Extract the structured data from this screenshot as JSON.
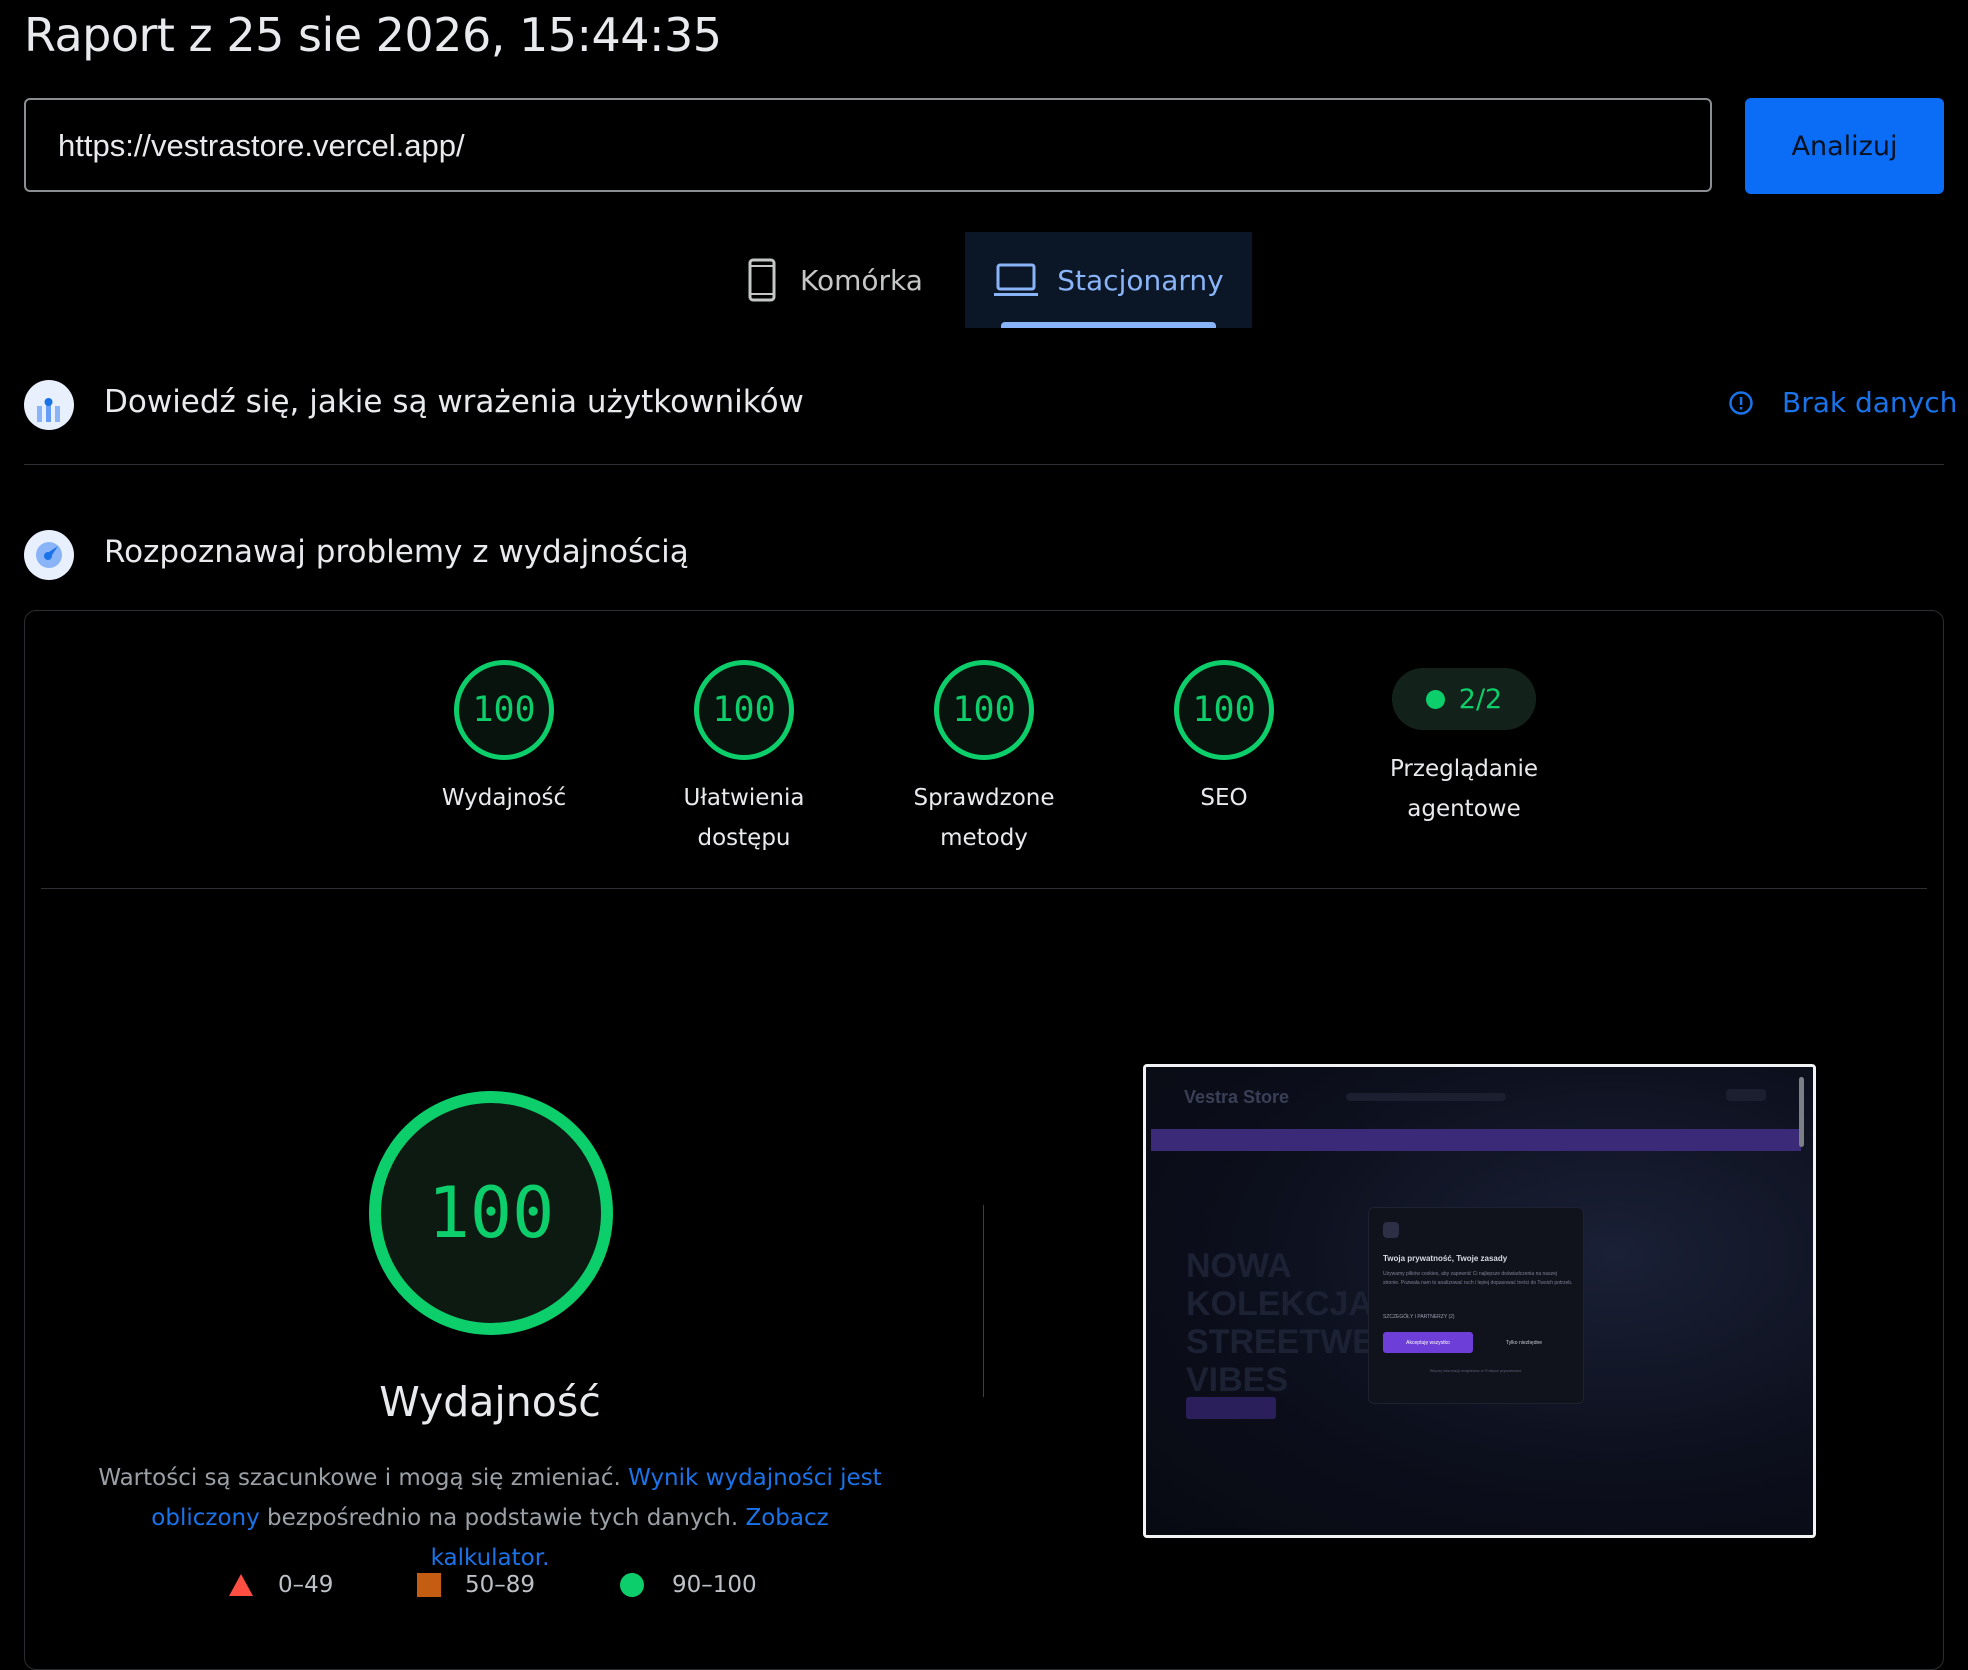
{
  "header": {
    "title": "Raport z 25 sie 2026, 15:44:35"
  },
  "url_input": {
    "value": "https://vestrastore.vercel.app/"
  },
  "analyze_button": {
    "label": "Analizuj"
  },
  "tabs": [
    {
      "label": "Komórka",
      "icon": "phone-icon",
      "active": false
    },
    {
      "label": "Stacjonarny",
      "icon": "laptop-icon",
      "active": true
    }
  ],
  "field_data": {
    "title": "Dowiedź się, jakie są wrażenia użytkowników",
    "status": "Brak danych",
    "status_icon": "info-icon"
  },
  "lab_data": {
    "title": "Rozpoznawaj problemy z wydajnością"
  },
  "scores": [
    {
      "value": "100",
      "label": "Wydajność"
    },
    {
      "value": "100",
      "label": "Ułatwienia dostępu"
    },
    {
      "value": "100",
      "label": "Sprawdzone metody"
    },
    {
      "value": "100",
      "label": "SEO"
    }
  ],
  "agentic": {
    "value": "2/2",
    "label": "Przeglądanie agentowe"
  },
  "performance": {
    "score": "100",
    "label": "Wydajność",
    "desc_before": "Wartości są szacunkowe i mogą się zmieniać. ",
    "desc_link1": "Wynik wydajności jest obliczony",
    "desc_middle": " bezpośrednio na podstawie tych danych. ",
    "desc_link2": "Zobacz kalkulator."
  },
  "legend": [
    {
      "range": "0–49",
      "shape": "triangle",
      "color": "#ff4e42"
    },
    {
      "range": "50–89",
      "shape": "square",
      "color": "#c45d12"
    },
    {
      "range": "90–100",
      "shape": "circle",
      "color": "#0cce6b"
    }
  ],
  "colors": {
    "accent": "#0b6cf5",
    "link": "#1a73e8",
    "good": "#0cce6b",
    "tab_active": "#8ab4f8"
  },
  "screenshot": {
    "brand": "Vestra Store",
    "hero_text": "NOWA KOLEKCJA STREETWEAR VIBES",
    "dialog_title": "Twoja prywatność, Twoje zasady",
    "dialog_body": "Używamy plików cookies, aby zapewnić Ci najlepsze doświadczenia na naszej stronie. Pozwala nam to analizować ruch i lepiej dopasować treści do Twoich potrzeb.",
    "dialog_select": "SZCZEGÓŁY I PARTNERZY (2)",
    "accept_label": "Akceptuję wszystko",
    "necessary_label": "Tylko niezbędne",
    "footer_text": "Więcej informacji znajdziesz w Polityce prywatności."
  }
}
